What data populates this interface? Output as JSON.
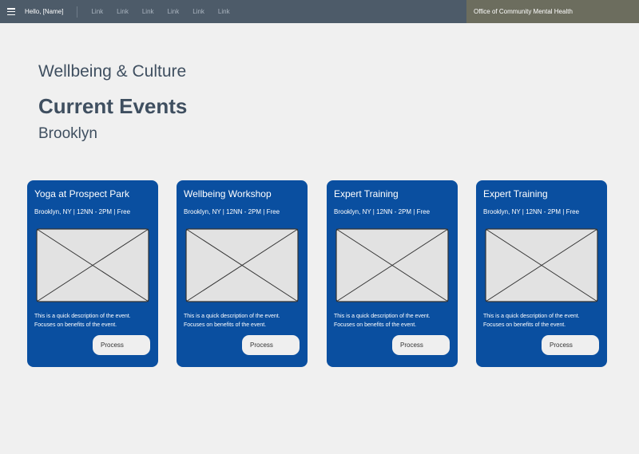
{
  "header": {
    "greeting": "Hello, [Name]",
    "links": [
      "Link",
      "Link",
      "Link",
      "Link",
      "Link",
      "Link"
    ],
    "organization": "Office of Community Mental Health"
  },
  "main": {
    "subtitle": "Wellbeing & Culture",
    "title": "Current Events",
    "location": "Brooklyn"
  },
  "events": [
    {
      "title": "Yoga at Prospect Park",
      "meta": "Brooklyn, NY | 12NN - 2PM | Free",
      "description_line1": "This is a quick description of the event.",
      "description_line2": "Focuses on benefits of the event.",
      "button": "Process"
    },
    {
      "title": "Wellbeing Workshop",
      "meta": "Brooklyn, NY | 12NN - 2PM | Free",
      "description_line1": "This is a quick description of the event.",
      "description_line2": "Focuses on benefits of the event.",
      "button": "Process"
    },
    {
      "title": "Expert Training",
      "meta": "Brooklyn, NY | 12NN - 2PM | Free",
      "description_line1": "This is a quick description of the event.",
      "description_line2": "Focuses on benefits of the event.",
      "button": "Process"
    },
    {
      "title": "Expert Training",
      "meta": "Brooklyn, NY | 12NN - 2PM | Free",
      "description_line1": "This is a quick description of the event.",
      "description_line2": "Focuses on benefits of the event.",
      "button": "Process"
    }
  ],
  "icons": {
    "menu": "hamburger-menu-icon",
    "image": "image-placeholder-icon"
  },
  "colors": {
    "topbar": "#4d5b69",
    "org_bar": "#6c6d5e",
    "card": "#0a4fa0",
    "heading": "#3f4f60",
    "background": "#f0f0f0"
  }
}
